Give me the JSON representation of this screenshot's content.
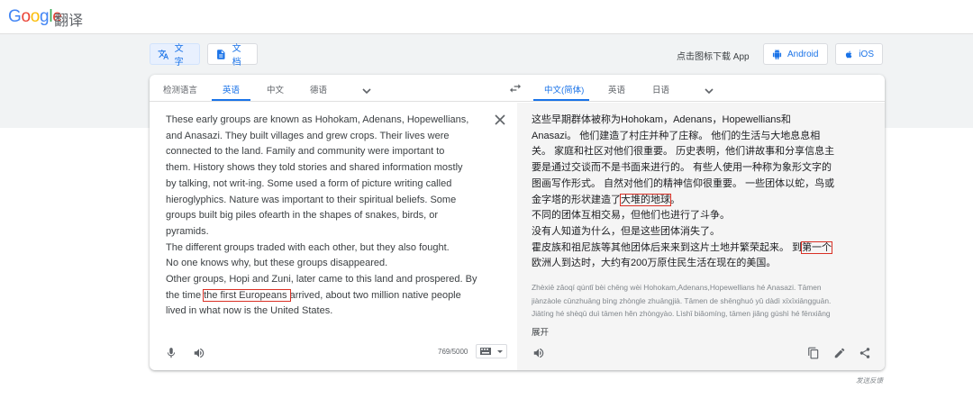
{
  "header": {
    "logo_letters": [
      "G",
      "o",
      "o",
      "g",
      "l",
      "e"
    ],
    "product": "翻译"
  },
  "modes": {
    "text_label": "文字",
    "docs_label": "文档"
  },
  "download": {
    "prompt": "点击图标下载 App",
    "android_label": "Android",
    "ios_label": "iOS"
  },
  "source_tabs": {
    "detect": "检测语言",
    "english": "英语",
    "chinese": "中文",
    "german": "德语"
  },
  "target_tabs": {
    "chinese_simplified": "中文(简体)",
    "english": "英语",
    "japanese": "日语"
  },
  "source": {
    "lines": [
      "These early groups are known as Hohokam, Adenans, Hopewellians,",
      "and Anasazi. They built villages and grew crops. Their lives were",
      "connected to the land. Family and community were important to",
      "them. History shows they told stories and shared information mostly",
      "by talking, not writ-ing. Some used a form of picture writing called",
      "hieroglyphics. Nature was important to their spiritual beliefs. Some",
      "groups built big piles ofearth in the shapes of snakes, birds, or",
      "pyramids.",
      "The different groups traded with each other, but they also fought.",
      "No one knows why, but these groups disappeared.",
      "Other groups, Hopi and Zuni, later came to this land and prospered. By"
    ],
    "last_line_before": "the time ",
    "last_line_highlight": "the first Europeans ",
    "last_line_after": "arrived, about two million native people",
    "final_line": "lived in what now is the United States.",
    "char_count": "769/5000"
  },
  "target": {
    "lines": [
      "这些早期群体被称为Hohokam，Adenans，Hopewellians和",
      "Anasazi。 他们建造了村庄并种了庄稼。 他们的生活与大地息息相",
      "关。 家庭和社区对他们很重要。 历史表明，他们讲故事和分享信息主",
      "要是通过交谈而不是书面来进行的。 有些人使用一种称为象形文字的",
      "图画写作形式。 自然对他们的精神信仰很重要。 一些团体以蛇，鸟或"
    ],
    "line6_before": "金字塔的形状建造了",
    "line6_highlight": "大堆的地球",
    "line6_after": "。",
    "more_lines": [
      "不同的团体互相交易，但他们也进行了斗争。",
      "没有人知道为什么，但是这些团体消失了。"
    ],
    "line9_before": "霍皮族和祖尼族等其他团体后来来到这片土地并繁荣起来。 到",
    "line9_highlight": "第一个",
    "last_line": "欧洲人到达时，大约有200万原住民生活在现在的美国。",
    "romanization": [
      "Zhèxiē zǎoqí qúntǐ bèi chēng wèi Hohokam,Adenans,Hopewellians hé Anasazi. Tāmen",
      "jiànzàole cūnzhuāng bìng zhòngle zhuāngjià. Tāmen de shēnghuó yǔ dàdì xīxīxiāngguān.",
      "Jiātíng hé shèqū duì tāmen hěn zhòngyào. Lìshǐ biǎomíng, tāmen jiǎng gùshì hé fēnxiǎng"
    ],
    "expand_label": "展开"
  },
  "footer": {
    "feedback": "发送反馈"
  },
  "colors": {
    "accent": "#1a73e8",
    "highlight_box": "#d93025",
    "band": "#f1f3f4"
  }
}
